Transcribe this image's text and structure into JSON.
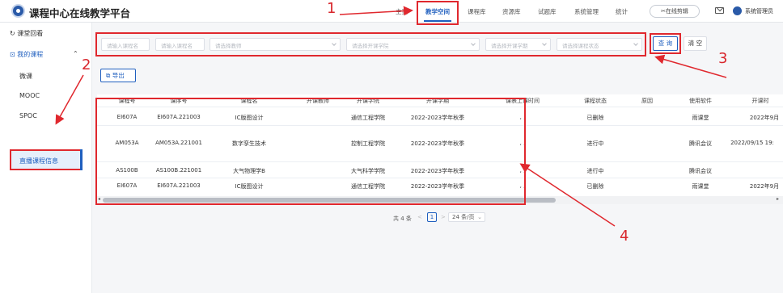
{
  "header": {
    "title": "课程中心在线教学平台",
    "nav": [
      "主页",
      "教学空间",
      "课程库",
      "资源库",
      "试题库",
      "系统管理",
      "统计"
    ],
    "edit_button": "✂在线剪辑",
    "user": "系统管理员"
  },
  "sidebar": {
    "items": [
      "课堂回看",
      "我的课程"
    ],
    "sub_items": [
      "微课",
      "MOOC",
      "SPOC",
      "直播课程信息"
    ]
  },
  "filters": {
    "course_name1": "请输入课程名",
    "course_name2": "请输入课程名",
    "teacher": "请选择教师",
    "college": "请选择开课学院",
    "term": "请选择开课学期",
    "status": "请选择课程状态"
  },
  "buttons": {
    "query": "查 询",
    "clear": "清 空",
    "export": "导出"
  },
  "table": {
    "headers": [
      "课程号",
      "课序号",
      "课程名",
      "开课教师",
      "开课学院",
      "开课学期",
      "课表上课时间",
      "课程状态",
      "原因",
      "使用软件",
      "开课时"
    ],
    "rows": [
      [
        "EI607A",
        "EI607A.221003",
        "IC版图设计",
        "",
        "通信工程学院",
        "2022-2023学年秋季",
        ", ,",
        "已删除",
        "",
        "雨课堂",
        "2022年9月"
      ],
      [
        "AM053A",
        "AM053A.221001",
        "数字孪生技术",
        "",
        "控制工程学院",
        "2022-2023学年秋季",
        ", ,",
        "进行中",
        "",
        "腾讯会议",
        "2022/09/15 19:"
      ],
      [
        "AS100B",
        "AS100B.221001",
        "大气物理学B",
        "",
        "大气科学学院",
        "2022-2023学年秋季",
        ", ,",
        "进行中",
        "",
        "腾讯会议",
        ""
      ],
      [
        "EI607A",
        "EI607A.221003",
        "IC版图设计",
        "",
        "通信工程学院",
        "2022-2023学年秋季",
        ", ,",
        "已删除",
        "",
        "雨课堂",
        "2022年9月"
      ]
    ]
  },
  "pagination": {
    "total": "共 4 条",
    "prev": "<",
    "page": "1",
    "next": ">",
    "size": "24 条/页"
  },
  "annotations": [
    "1",
    "2",
    "3",
    "4"
  ]
}
